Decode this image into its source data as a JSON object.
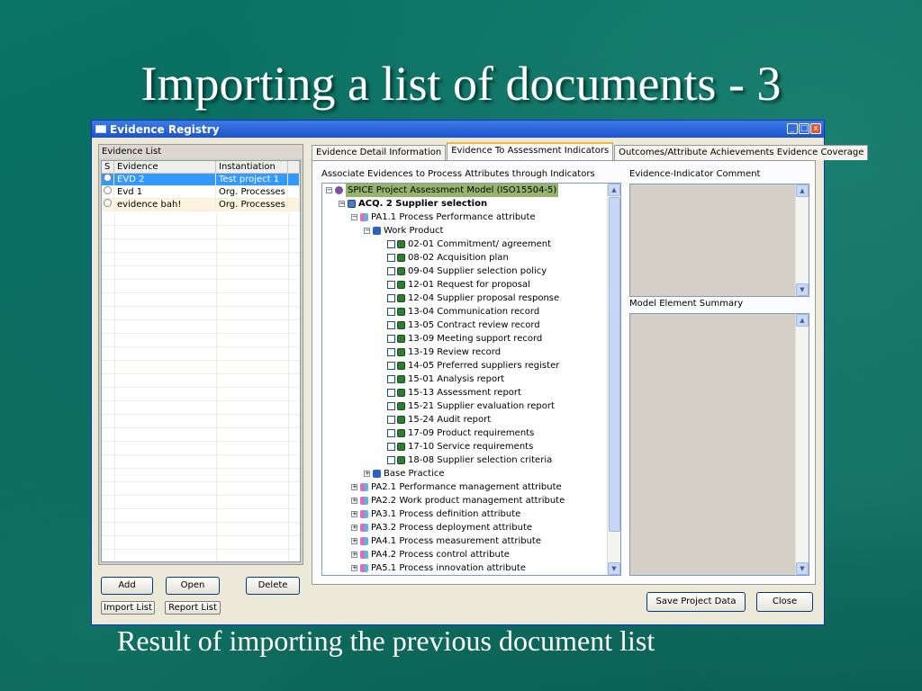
{
  "slide": {
    "title": "Importing a list of documents - 3",
    "caption": "Result of importing the previous document list"
  },
  "window": {
    "title": "Evidence Registry",
    "controls": {
      "minimize": "_",
      "maximize": "□",
      "close": "x"
    }
  },
  "evidence_list": {
    "label": "Evidence List",
    "columns": {
      "s": "S",
      "evidence": "Evidence",
      "instantiation": "Instantiation"
    },
    "rows": [
      {
        "evidence": "EVD 2",
        "instantiation": "Test project 1"
      },
      {
        "evidence": "Evd 1",
        "instantiation": "Org. Processes"
      },
      {
        "evidence": "evidence bah!",
        "instantiation": "Org. Processes"
      }
    ],
    "buttons": {
      "add": "Add",
      "open": "Open",
      "delete": "Delete",
      "import_list": "Import List",
      "report_list": "Report List"
    }
  },
  "tabs": [
    {
      "label": "Evidence Detail Information"
    },
    {
      "label": "Evidence To Assessment Indicators"
    },
    {
      "label": "Outcomes/Attribute Achievements Evidence Coverage"
    }
  ],
  "assoc": {
    "label": "Associate Evidences to Process Attributes through Indicators",
    "comment_label": "Evidence-Indicator Comment",
    "summary_label": "Model Element Summary"
  },
  "tree": {
    "root": "SPICE  Project Assessment Model (ISO15504-5)",
    "process": "ACQ. 2 Supplier selection",
    "pa11": "PA1.1 Process Performance attribute",
    "work_product": "Work Product",
    "documents": [
      "02-01 Commitment/ agreement",
      "08-02 Acquisition plan",
      "09-04 Supplier selection policy",
      "12-01 Request for proposal",
      "12-04 Supplier proposal response",
      "13-04 Communication record",
      "13-05 Contract review record",
      "13-09 Meeting support record",
      "13-19 Review record",
      "14-05 Preferred suppliers register",
      "15-01 Analysis report",
      "15-13 Assessment report",
      "15-21 Supplier evaluation report",
      "15-24 Audit report",
      "17-09 Product requirements",
      "17-10 Service requirements",
      "18-08 Supplier selection criteria"
    ],
    "base_practice": "Base Practice",
    "attributes": [
      "PA2.1 Performance management attribute",
      "PA2.2 Work product management attribute",
      "PA3.1 Process definition attribute",
      "PA3.2 Process deployment attribute",
      "PA4.1 Process measurement attribute",
      "PA4.2 Process control attribute",
      "PA5.1 Process innovation attribute"
    ]
  },
  "footer": {
    "save": "Save Project Data",
    "close": "Close"
  }
}
